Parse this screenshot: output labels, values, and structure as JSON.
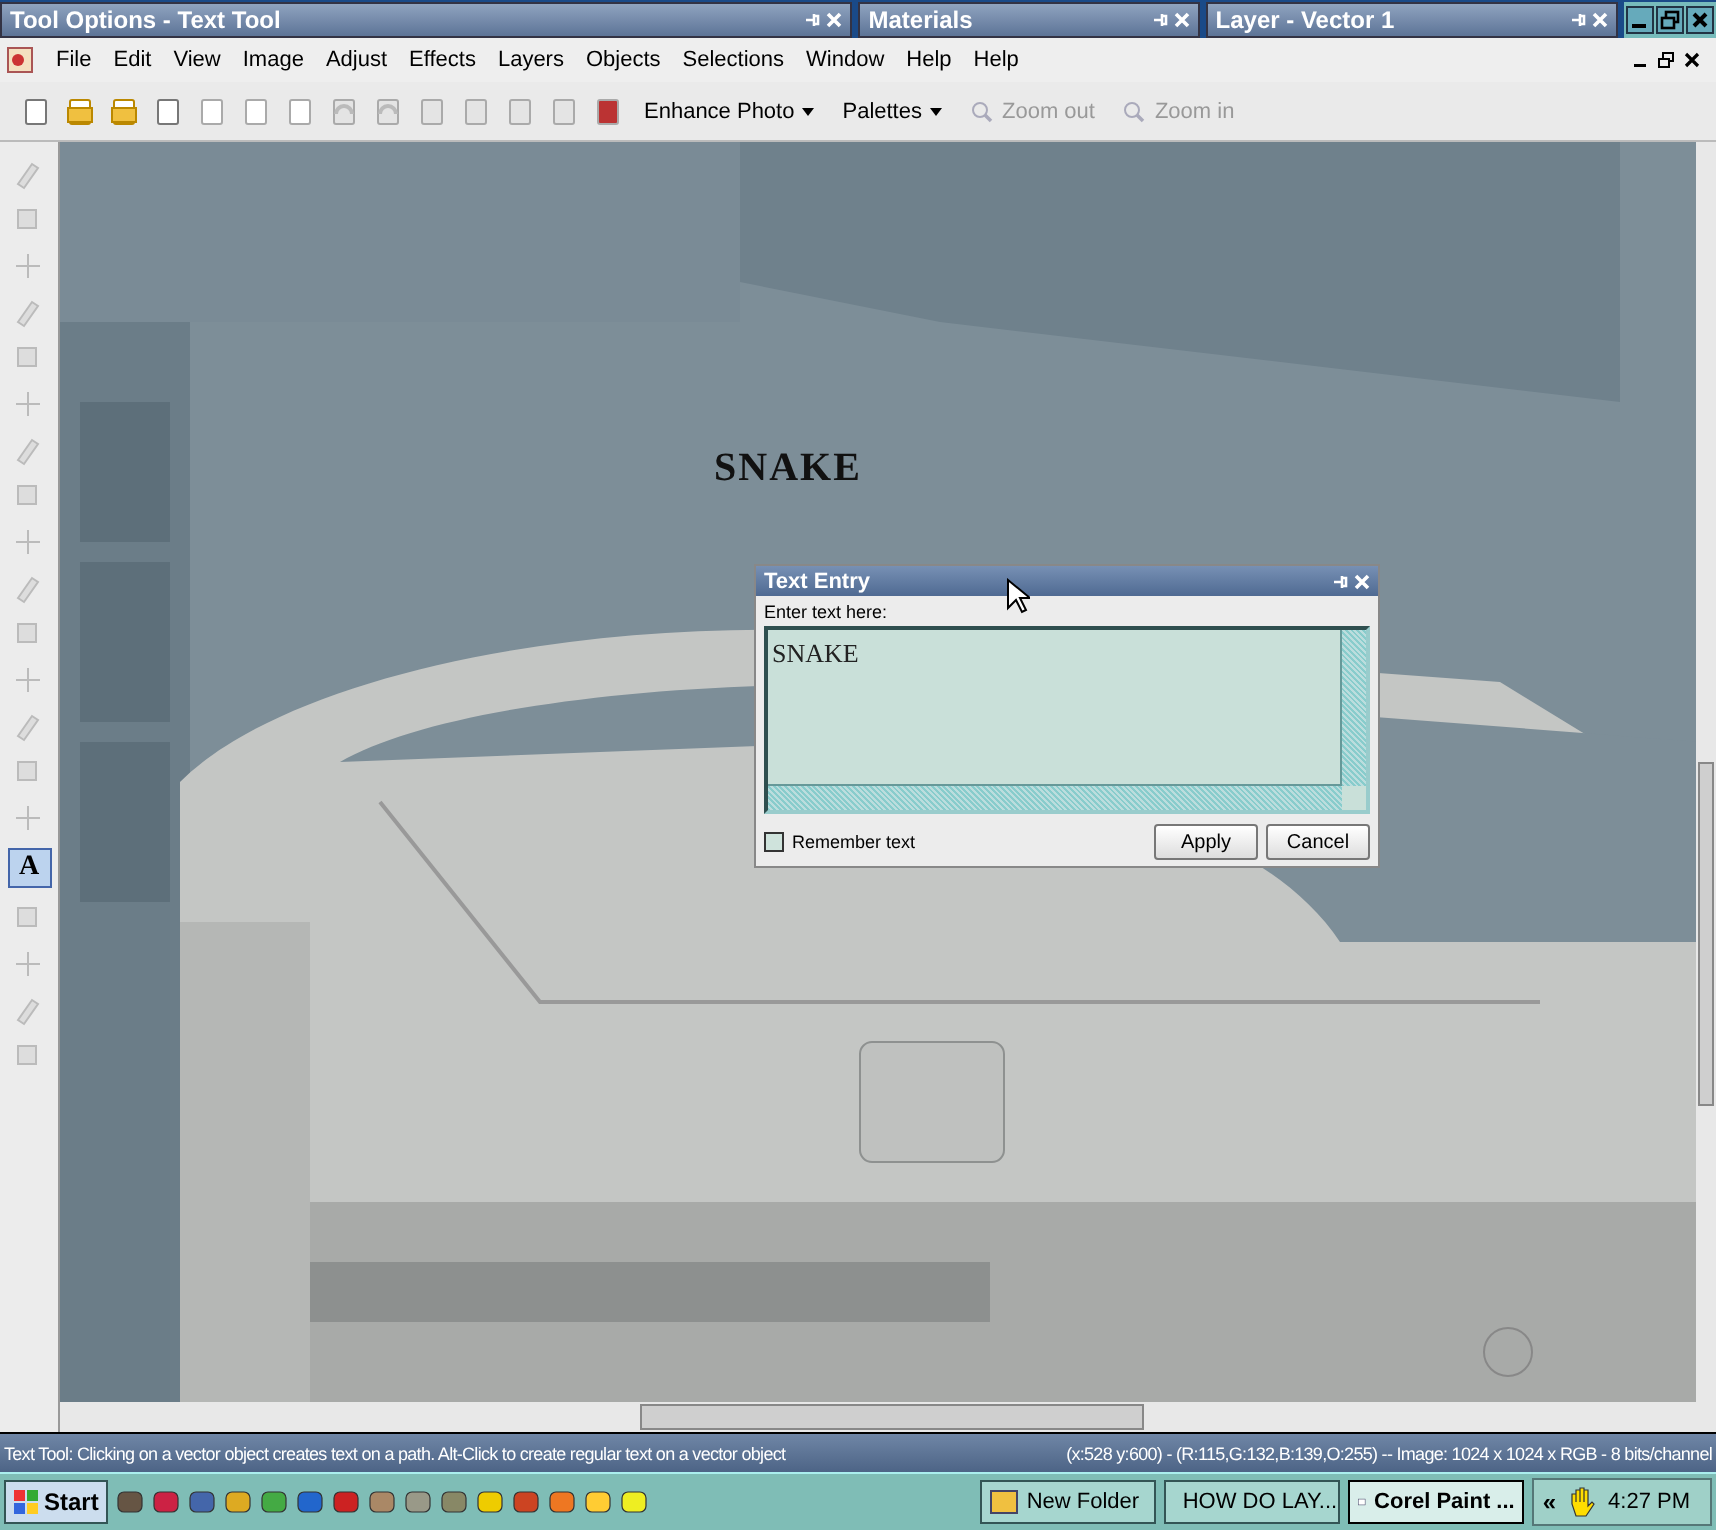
{
  "panels": [
    {
      "title": "Tool Options - Text Tool"
    },
    {
      "title": "Materials"
    },
    {
      "title": "Layer - Vector 1"
    }
  ],
  "menu": [
    "File",
    "Edit",
    "View",
    "Image",
    "Adjust",
    "Effects",
    "Layers",
    "Objects",
    "Selections",
    "Window",
    "Help",
    "Help"
  ],
  "toolbar": [
    {
      "label": "Enhance Photo",
      "dropdown": true,
      "disabled": false
    },
    {
      "label": "Palettes",
      "dropdown": true,
      "disabled": false
    },
    {
      "label": "Zoom out",
      "dropdown": false,
      "disabled": true
    },
    {
      "label": "Zoom in",
      "dropdown": false,
      "disabled": true
    }
  ],
  "tools": [
    {
      "kind": "icon",
      "selected": false
    },
    {
      "kind": "icon",
      "selected": false
    },
    {
      "kind": "icon",
      "selected": false
    },
    {
      "kind": "icon",
      "selected": false
    },
    {
      "kind": "icon",
      "selected": false
    },
    {
      "kind": "icon",
      "selected": false
    },
    {
      "kind": "icon",
      "selected": false
    },
    {
      "kind": "icon",
      "selected": false
    },
    {
      "kind": "icon",
      "selected": false
    },
    {
      "kind": "icon",
      "selected": false
    },
    {
      "kind": "icon",
      "selected": false
    },
    {
      "kind": "icon",
      "selected": false
    },
    {
      "kind": "icon",
      "selected": false
    },
    {
      "kind": "icon",
      "selected": false
    },
    {
      "kind": "icon",
      "selected": false
    },
    {
      "kind": "text",
      "label": "A",
      "selected": true
    },
    {
      "kind": "icon",
      "selected": false
    },
    {
      "kind": "icon",
      "selected": false
    },
    {
      "kind": "icon",
      "selected": false
    },
    {
      "kind": "icon",
      "selected": false
    }
  ],
  "canvas": {
    "kind": "picture",
    "text": "SNAKE"
  },
  "dialog": {
    "title": "Text Entry",
    "prompt": "Enter text here:",
    "value": "SNAKE",
    "remember": {
      "label": "Remember text",
      "checked": false
    },
    "buttons": [
      "Apply",
      "Cancel"
    ]
  },
  "status_bar": {
    "hint": "Text Tool: Clicking on a vector object creates text on a path. Alt-Click to create regular text on a vector object",
    "info": "(x:528 y:600) - (R:115,G:132,B:139,O:255) -- Image:  1024 x 1024 x RGB - 8 bits/channel"
  },
  "taskbar": {
    "start": "Start",
    "tasks": [
      {
        "label": "New Folder",
        "selected": false
      },
      {
        "label": "HOW DO LAY...",
        "selected": false
      },
      {
        "label": "Corel Paint ...",
        "selected": true
      }
    ],
    "tray_toggle": "«",
    "clock": "4:27 PM"
  }
}
